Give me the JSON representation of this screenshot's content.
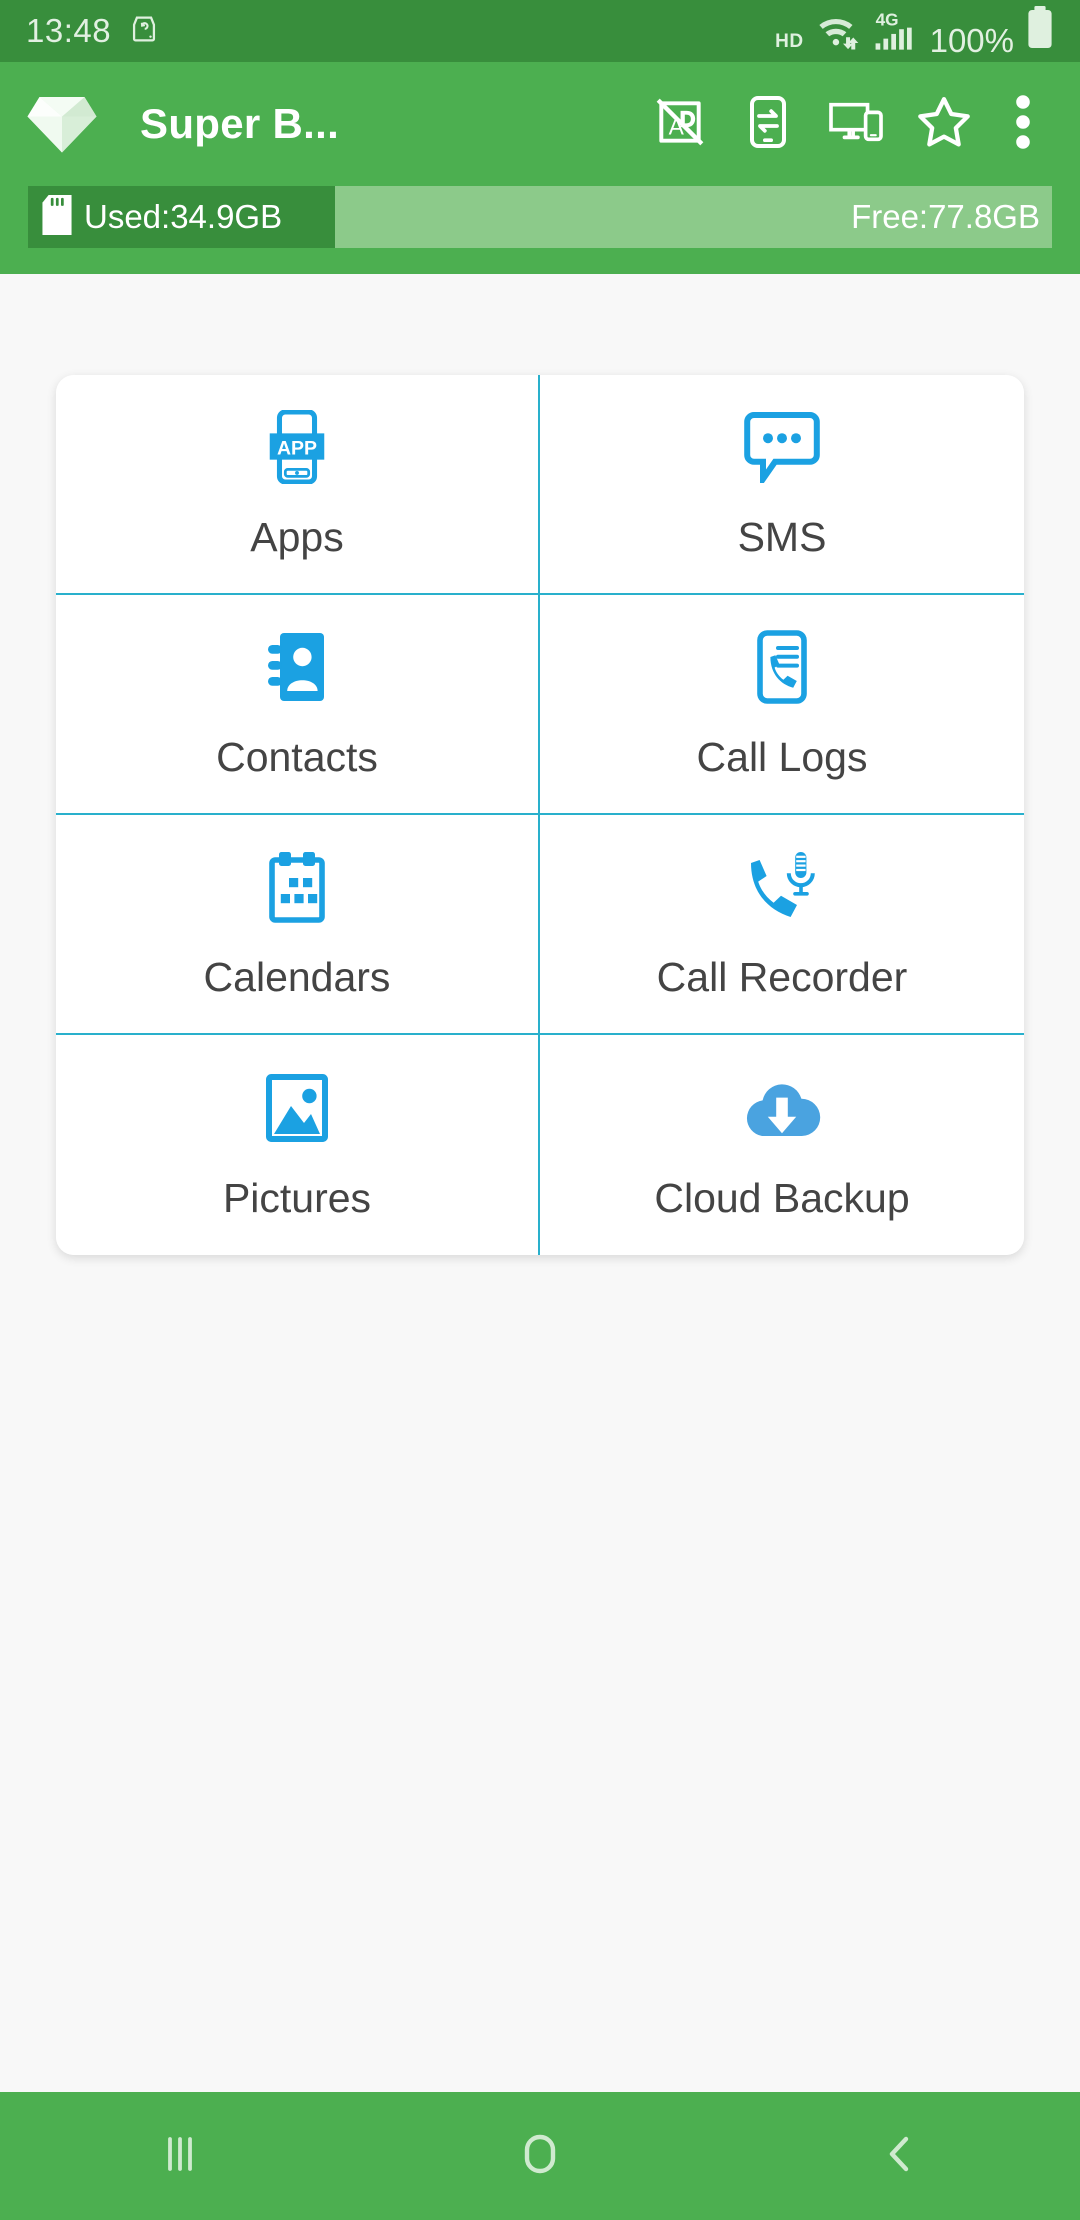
{
  "colors": {
    "status_bar": "#388e3c",
    "app_bar": "#4caf50",
    "accent_blue": "#1ba1e2",
    "cloud_blue": "#4aa3e0",
    "divider": "#29b0cc",
    "page_bg": "#f8f8f8",
    "label_text": "#444444"
  },
  "status_bar": {
    "time": "13:48",
    "left_icons": [
      "backup-drive-icon"
    ],
    "hd_label": "HD",
    "right_icons": [
      "wifi-icon",
      "signal-4g-icon",
      "battery-icon"
    ],
    "network_label": "4G",
    "battery_percent": "100%"
  },
  "app_bar": {
    "logo_icon": "diamond-gem-icon",
    "title": "Super B...",
    "actions": [
      {
        "name": "no-ads-button",
        "icon": "no-ads-icon"
      },
      {
        "name": "phone-transfer-button",
        "icon": "phone-transfer-icon"
      },
      {
        "name": "device-sync-button",
        "icon": "desktop-mobile-icon"
      },
      {
        "name": "favorite-button",
        "icon": "star-outline-icon"
      },
      {
        "name": "overflow-menu-button",
        "icon": "more-vertical-icon"
      }
    ]
  },
  "storage": {
    "sd_icon": "sd-card-icon",
    "used_label": "Used:34.9GB",
    "free_label": "Free:77.8GB",
    "used_percent": 30
  },
  "grid": {
    "items": [
      {
        "label": "Apps",
        "icon": "apps-phone-icon"
      },
      {
        "label": "SMS",
        "icon": "sms-bubble-icon"
      },
      {
        "label": "Contacts",
        "icon": "contacts-book-icon"
      },
      {
        "label": "Call Logs",
        "icon": "call-logs-icon"
      },
      {
        "label": "Calendars",
        "icon": "calendar-icon"
      },
      {
        "label": "Call Recorder",
        "icon": "call-recorder-icon"
      },
      {
        "label": "Pictures",
        "icon": "picture-image-icon"
      },
      {
        "label": "Cloud Backup",
        "icon": "cloud-download-icon"
      }
    ]
  },
  "nav_bar": {
    "buttons": [
      {
        "name": "recents-button",
        "icon": "recents-icon"
      },
      {
        "name": "home-button",
        "icon": "home-icon"
      },
      {
        "name": "back-button",
        "icon": "back-chevron-icon"
      }
    ]
  }
}
